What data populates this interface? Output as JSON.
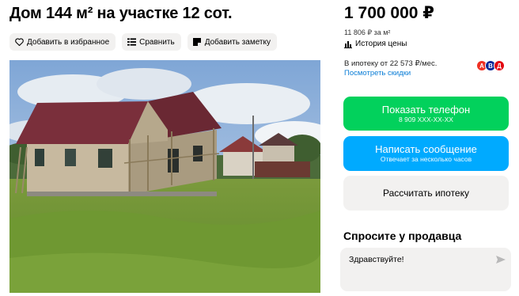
{
  "listing": {
    "title": "Дом 144 м² на участке 12 сот."
  },
  "actions": {
    "favorite_label": "Добавить в избранное",
    "compare_label": "Сравнить",
    "note_label": "Добавить заметку"
  },
  "price": {
    "value": "1 700 000 ₽",
    "per_m2": "11 806 ₽ за м²",
    "history_label": "История цены"
  },
  "mortgage": {
    "monthly": "В ипотеку от 22 573 ₽/мес.",
    "discount_link": "Посмотреть скидки",
    "banks": [
      {
        "letter": "А",
        "color": "#ef3124"
      },
      {
        "letter": "В",
        "color": "#0a2896"
      },
      {
        "letter": "Д",
        "color": "#e30611"
      }
    ]
  },
  "buttons": {
    "phone_label": "Показать телефон",
    "phone_number": "8 909 XXX-XX-XX",
    "message_label": "Написать сообщение",
    "message_sub": "Отвечает за несколько часов",
    "mortgage_label": "Рассчитать ипотеку"
  },
  "ask": {
    "title": "Спросите у продавца",
    "message": "Здравствуйте!"
  },
  "colors": {
    "green": "#02d15c",
    "blue": "#00aaff",
    "link": "#0a7dd6",
    "grey_bg": "#f2f1f0"
  },
  "icons": {
    "favorite": "heart-icon",
    "compare": "compare-icon",
    "note": "note-icon",
    "history": "chart-icon",
    "send": "send-icon"
  }
}
